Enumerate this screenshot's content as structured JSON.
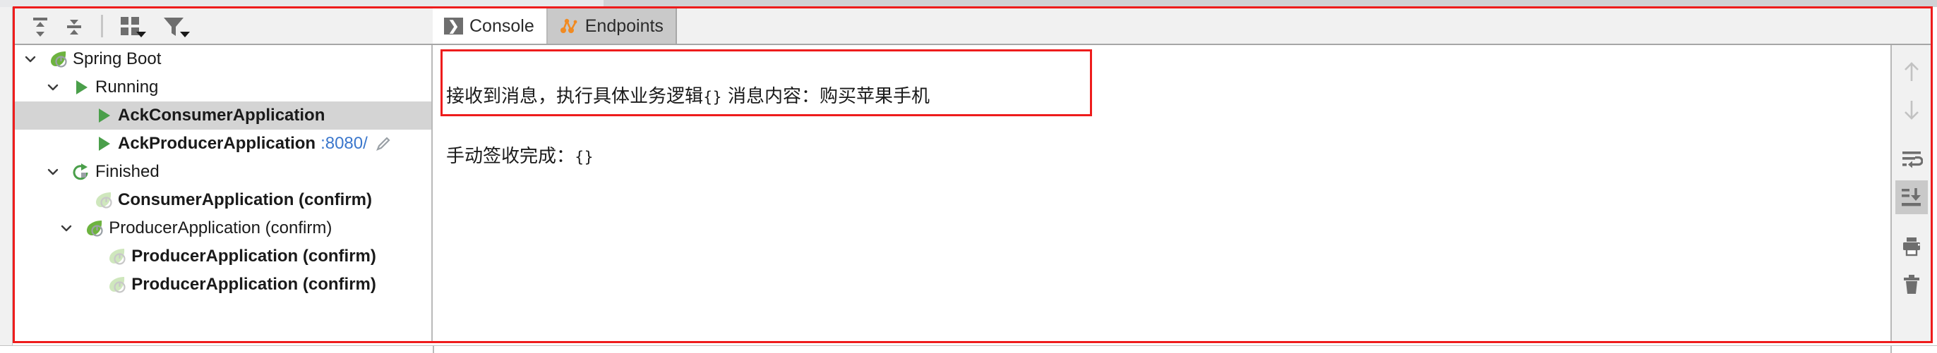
{
  "toolbar": {
    "buttons": [
      {
        "name": "expand-all-icon",
        "label": "Expand All"
      },
      {
        "name": "collapse-all-icon",
        "label": "Collapse All"
      },
      {
        "name": "group-by-icon",
        "label": "Group By"
      },
      {
        "name": "filter-icon",
        "label": "Filter"
      }
    ]
  },
  "tabs": [
    {
      "label": "Console",
      "icon": "console-icon",
      "active": true
    },
    {
      "label": "Endpoints",
      "icon": "endpoints-icon",
      "active": false
    }
  ],
  "tree": {
    "rows": [
      {
        "label": "Spring Boot",
        "indent": 0,
        "chevron": "down",
        "icon": "spring-boot-icon",
        "bold": false,
        "selected": false,
        "port": "",
        "pencil": false
      },
      {
        "label": "Running",
        "indent": 1,
        "chevron": "down",
        "icon": "run-green-icon",
        "bold": false,
        "selected": false,
        "port": "",
        "pencil": false
      },
      {
        "label": "AckConsumerApplication",
        "indent": 2,
        "chevron": "none",
        "icon": "run-green-icon",
        "bold": true,
        "selected": true,
        "port": "",
        "pencil": false
      },
      {
        "label": "AckProducerApplication",
        "indent": 2,
        "chevron": "none",
        "icon": "run-green-icon",
        "bold": true,
        "selected": false,
        "port": ":8080/",
        "pencil": true
      },
      {
        "label": "Finished",
        "indent": 1,
        "chevron": "down",
        "icon": "rerun-icon",
        "bold": false,
        "selected": false,
        "port": "",
        "pencil": false
      },
      {
        "label": "ConsumerApplication (confirm)",
        "indent": 2,
        "chevron": "none",
        "icon": "spring-boot-faded-icon",
        "bold": true,
        "selected": false,
        "port": "",
        "pencil": false
      },
      {
        "label": "ProducerApplication (confirm)",
        "indent": 1.6,
        "chevron": "down",
        "icon": "spring-boot-icon",
        "bold": false,
        "selected": false,
        "port": "",
        "pencil": false
      },
      {
        "label": "ProducerApplication (confirm)",
        "indent": 2.6,
        "chevron": "none",
        "icon": "spring-boot-faded-icon",
        "bold": true,
        "selected": false,
        "port": "",
        "pencil": false
      },
      {
        "label": "ProducerApplication (confirm)",
        "indent": 2.6,
        "chevron": "none",
        "icon": "spring-boot-faded-icon",
        "bold": true,
        "selected": false,
        "port": "",
        "pencil": false
      }
    ]
  },
  "console": {
    "line1_a": "接收到消息，执行具体业务逻辑",
    "line1_b": "{}",
    "line1_c": " 消息内容：购买苹果手机",
    "line2_a": "手动签收完成：",
    "line2_b": "{}"
  },
  "right_rail": {
    "buttons": [
      {
        "name": "scroll-up-icon",
        "label": "Up the Stack Trace",
        "state": "disabled"
      },
      {
        "name": "scroll-down-icon",
        "label": "Down the Stack Trace",
        "state": "disabled"
      },
      {
        "name": "soft-wrap-icon",
        "label": "Soft-Wrap",
        "state": "normal"
      },
      {
        "name": "scroll-to-end-icon",
        "label": "Scroll to the End",
        "state": "active"
      },
      {
        "name": "print-icon",
        "label": "Print",
        "state": "normal"
      },
      {
        "name": "trash-icon",
        "label": "Clear All",
        "state": "normal"
      }
    ]
  },
  "colors": {
    "annotation_red": "#ee1c1c",
    "selection_gray": "#d4d4d4",
    "spring_green": "#6db33f",
    "link_blue": "#3b77cc",
    "endpoints_orange": "#f18a21",
    "icon_gray": "#6e6e6e"
  }
}
